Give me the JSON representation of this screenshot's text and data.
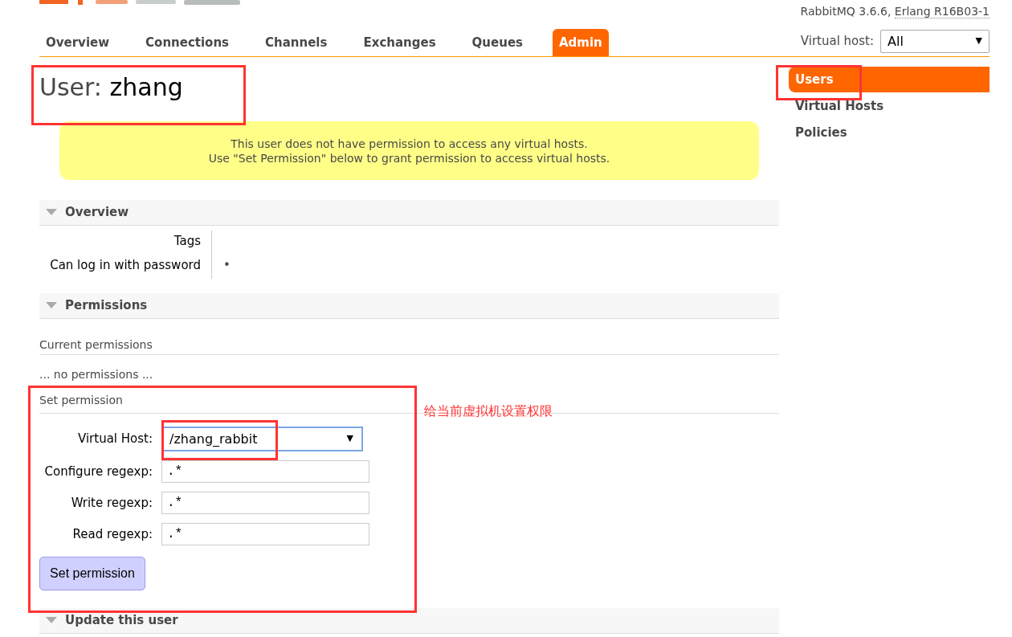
{
  "header": {
    "version": "RabbitMQ 3.6.6, ",
    "erlang": "Erlang R16B03-1",
    "vhost_label": "Virtual host:",
    "vhost_value": "All",
    "vhost_caret": "▼"
  },
  "nav": [
    {
      "label": "Overview",
      "selected": false
    },
    {
      "label": "Connections",
      "selected": false
    },
    {
      "label": "Channels",
      "selected": false
    },
    {
      "label": "Exchanges",
      "selected": false
    },
    {
      "label": "Queues",
      "selected": false
    },
    {
      "label": "Admin",
      "selected": true
    }
  ],
  "title": {
    "prefix": "User:",
    "name": "zhang"
  },
  "notice": [
    "This user does not have permission to access any virtual hosts.",
    "Use \"Set Permission\" below to grant permission to access virtual hosts."
  ],
  "overview": {
    "heading": "Overview",
    "expanded": true,
    "rows": [
      {
        "label": "Tags"
      },
      {
        "label": "Can log in with password",
        "value": "•"
      }
    ]
  },
  "permissions": {
    "heading": "Permissions",
    "expanded": true,
    "current_label": "Current permissions",
    "empty_text": "... no permissions ...",
    "set_label": "Set permission",
    "vhost_label": "Virtual Host:",
    "vhost_value": "/zhang_rabbit",
    "vhost_caret": "▼",
    "fields": [
      {
        "label": "Configure regexp:",
        "value": ".*"
      },
      {
        "label": "Write regexp:",
        "value": ".*"
      },
      {
        "label": "Read regexp:",
        "value": ".*"
      }
    ],
    "button": "Set permission"
  },
  "update": {
    "heading": "Update this user",
    "expanded": true
  },
  "sidebar": [
    {
      "label": "Users",
      "selected": true
    },
    {
      "label": "Virtual Hosts",
      "selected": false
    },
    {
      "label": "Policies",
      "selected": false
    }
  ],
  "annotation": "给当前虚拟机设置权限"
}
